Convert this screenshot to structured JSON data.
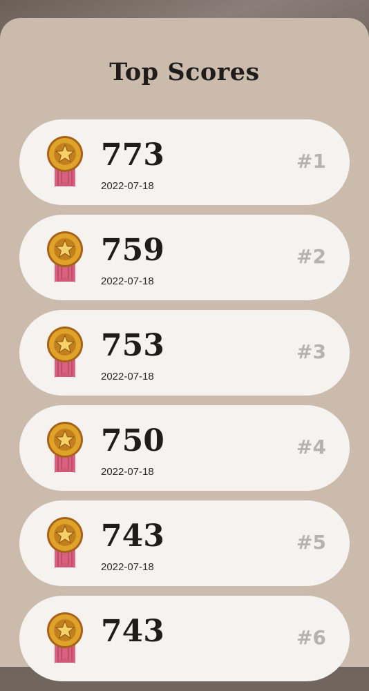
{
  "page": {
    "title": "Top Scores"
  },
  "colors": {
    "sheet": "#cabbad",
    "card": "#f6f2ef",
    "rank_text": "#b5b2b0",
    "score_text": "#1f1c1a",
    "medal_gold": "#e0a32a",
    "ribbon": "#cf5a78"
  },
  "scores": [
    {
      "score": "773",
      "date": "2022-07-18",
      "rank": "#1",
      "icon": "medal-icon"
    },
    {
      "score": "759",
      "date": "2022-07-18",
      "rank": "#2",
      "icon": "medal-icon"
    },
    {
      "score": "753",
      "date": "2022-07-18",
      "rank": "#3",
      "icon": "medal-icon"
    },
    {
      "score": "750",
      "date": "2022-07-18",
      "rank": "#4",
      "icon": "medal-icon"
    },
    {
      "score": "743",
      "date": "2022-07-18",
      "rank": "#5",
      "icon": "medal-icon"
    },
    {
      "score": "743",
      "date": "",
      "rank": "#6",
      "icon": "medal-icon"
    }
  ]
}
